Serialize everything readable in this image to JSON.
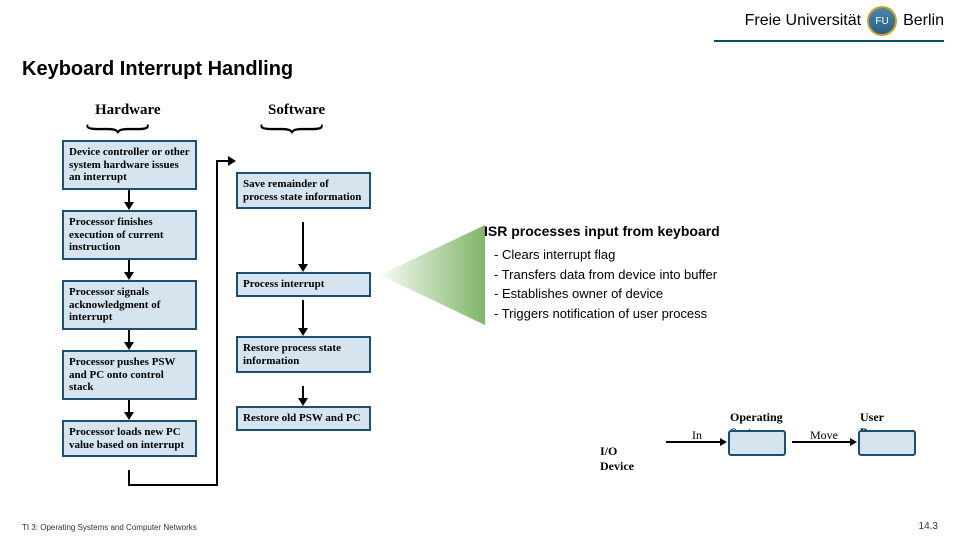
{
  "header": {
    "institution_pre": "Freie Universität",
    "institution_post": "Berlin",
    "seal_initials": "FU"
  },
  "title": "Keyboard Interrupt Handling",
  "columns": {
    "hardware": "Hardware",
    "software": "Software"
  },
  "hw_boxes": [
    "Device controller or other system hardware issues an interrupt",
    "Processor finishes execution of current instruction",
    "Processor signals acknowledgment of interrupt",
    "Processor pushes PSW and PC onto control stack",
    "Processor loads new PC value based on interrupt"
  ],
  "sw_boxes": [
    "Save remainder of process state information",
    "Process interrupt",
    "Restore process state information",
    "Restore old PSW and PC"
  ],
  "isr": {
    "title": "ISR processes input from keyboard",
    "items": [
      "Clears interrupt flag",
      "Transfers data from device into buffer",
      "Establishes owner of device",
      "Triggers notification of user process"
    ]
  },
  "mini": {
    "io": "I/O Device",
    "os": "Operating System",
    "up": "User Process",
    "in": "In",
    "move": "Move"
  },
  "footer": {
    "left": "TI 3: Operating Systems and Computer Networks",
    "right": "14.3"
  }
}
